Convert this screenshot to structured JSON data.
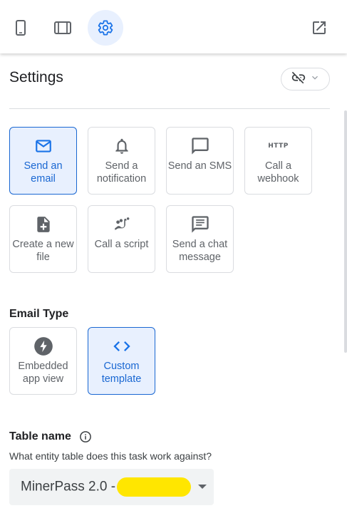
{
  "toolbar": {
    "buttons": [
      {
        "icon": "phone-icon",
        "active": false
      },
      {
        "icon": "tablet-icon",
        "active": false
      },
      {
        "icon": "gear-icon",
        "active": true
      },
      {
        "icon": "open-in-new-icon",
        "active": false
      }
    ],
    "accent_color": "#1a73e8",
    "active_bg": "#e8f0fe"
  },
  "settings": {
    "title": "Settings",
    "link_toggle_icon": "link-off-icon"
  },
  "actions": [
    {
      "label": "Send an email",
      "icon": "mail-icon",
      "selected": true
    },
    {
      "label": "Send a notification",
      "icon": "bell-icon",
      "selected": false
    },
    {
      "label": "Send an SMS",
      "icon": "message-icon",
      "selected": false
    },
    {
      "label": "Call a webhook",
      "icon": "http-icon",
      "icon_text": "HTTP",
      "selected": false
    },
    {
      "label": "Create a new file",
      "icon": "new-file-icon",
      "selected": false
    },
    {
      "label": "Call a script",
      "icon": "script-icon",
      "selected": false
    },
    {
      "label": "Send a chat message",
      "icon": "chat-icon",
      "selected": false
    }
  ],
  "email_type": {
    "label": "Email Type",
    "options": [
      {
        "label": "Embedded app view",
        "icon": "bolt-icon",
        "selected": false
      },
      {
        "label": "Custom template",
        "icon": "code-icon",
        "selected": true
      }
    ]
  },
  "table": {
    "label": "Table name",
    "helper": "What entity table does this task work against?",
    "value": "MinerPass 2.0 -",
    "redaction_color": "#ffe600"
  }
}
